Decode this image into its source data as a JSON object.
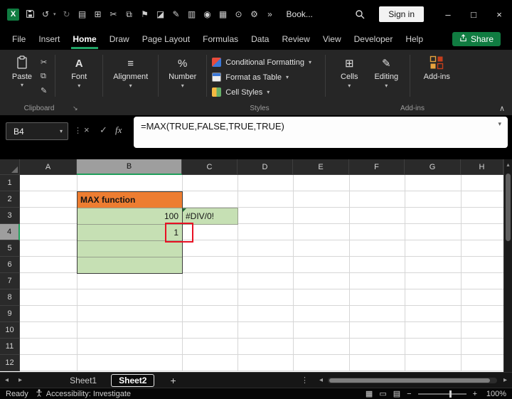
{
  "colors": {
    "accent_green": "#107C41",
    "tab_underline": "#21A366",
    "cell_orange_fill": "#ED7D31",
    "cell_green_fill": "#C6E0B4",
    "annotation_red": "#E81123",
    "selected_header_gray": "#9E9E9E"
  },
  "glyphs": {
    "excel_x": "X",
    "undo": "↺",
    "redo": "↻",
    "clipboard": "▤",
    "table": "⊞",
    "scissors": "✂",
    "copy": "⧉",
    "flag": "⚑",
    "chart": "◪",
    "pencil": "✎",
    "document": "▥",
    "camera": "◉",
    "print_grid": "▦",
    "pin": "⊙",
    "gear": "⚙",
    "overflow": "»",
    "minimize": "–",
    "maximize": "□",
    "close": "×",
    "chevron_down": "▾",
    "collapse_up": "∧",
    "dots_vertical": "⋮",
    "check": "✓",
    "arrow_left": "◂",
    "arrow_right": "▸",
    "arrow_up": "▴",
    "add_sheet": "+",
    "launcher": "↘",
    "align_lines": "≡",
    "percent": "%",
    "view_normal": "▦",
    "view_layout": "▭",
    "view_break": "▤",
    "zoom_out": "−",
    "zoom_in": "+"
  },
  "titlebar": {
    "workbook_name": "Book...",
    "signin_label": "Sign in"
  },
  "menu": {
    "tabs": [
      "File",
      "Insert",
      "Home",
      "Draw",
      "Page Layout",
      "Formulas",
      "Data",
      "Review",
      "View",
      "Developer",
      "Help"
    ],
    "active_tab": "Home",
    "share_label": "Share"
  },
  "ribbon": {
    "paste_label": "Paste",
    "font_icon": "A",
    "font_label": "Font",
    "alignment_label": "Alignment",
    "number_label": "Number",
    "conditional_formatting_label": "Conditional Formatting",
    "format_as_table_label": "Format as Table",
    "cell_styles_label": "Cell Styles",
    "cells_label": "Cells",
    "editing_label": "Editing",
    "addins_label": "Add-ins",
    "groups": {
      "clipboard": "Clipboard",
      "styles": "Styles",
      "addins": "Add-ins"
    }
  },
  "formula": {
    "name_box": "B4",
    "fx_label": "fx",
    "expression": "=MAX(TRUE,FALSE,TRUE,TRUE)"
  },
  "grid": {
    "columns": [
      "A",
      "B",
      "C",
      "D",
      "E",
      "F",
      "G",
      "H"
    ],
    "rows": [
      "1",
      "2",
      "3",
      "4",
      "5",
      "6",
      "7",
      "8",
      "9",
      "10",
      "11",
      "12"
    ],
    "selected_cell": "B4",
    "selected_column": "B",
    "selected_row": "4",
    "cells": {
      "b2": {
        "ref": "B2",
        "text": "MAX function",
        "fill": "#ED7D31"
      },
      "b3": {
        "ref": "B3",
        "text": "100",
        "fill": "#C6E0B4"
      },
      "b4": {
        "ref": "B4",
        "text": "1",
        "fill": "#C6E0B4"
      },
      "b5": {
        "ref": "B5",
        "text": "",
        "fill": "#C6E0B4"
      },
      "b6": {
        "ref": "B6",
        "text": "",
        "fill": "#C6E0B4"
      },
      "c3": {
        "ref": "C3",
        "text": "#DIV/0!",
        "fill": "#C6E0B4"
      }
    }
  },
  "sheetbar": {
    "sheet1": "Sheet1",
    "sheet2": "Sheet2",
    "active": "Sheet2"
  },
  "statusbar": {
    "mode": "Ready",
    "accessibility_label": "Accessibility: Investigate",
    "zoom_value": "100%"
  }
}
